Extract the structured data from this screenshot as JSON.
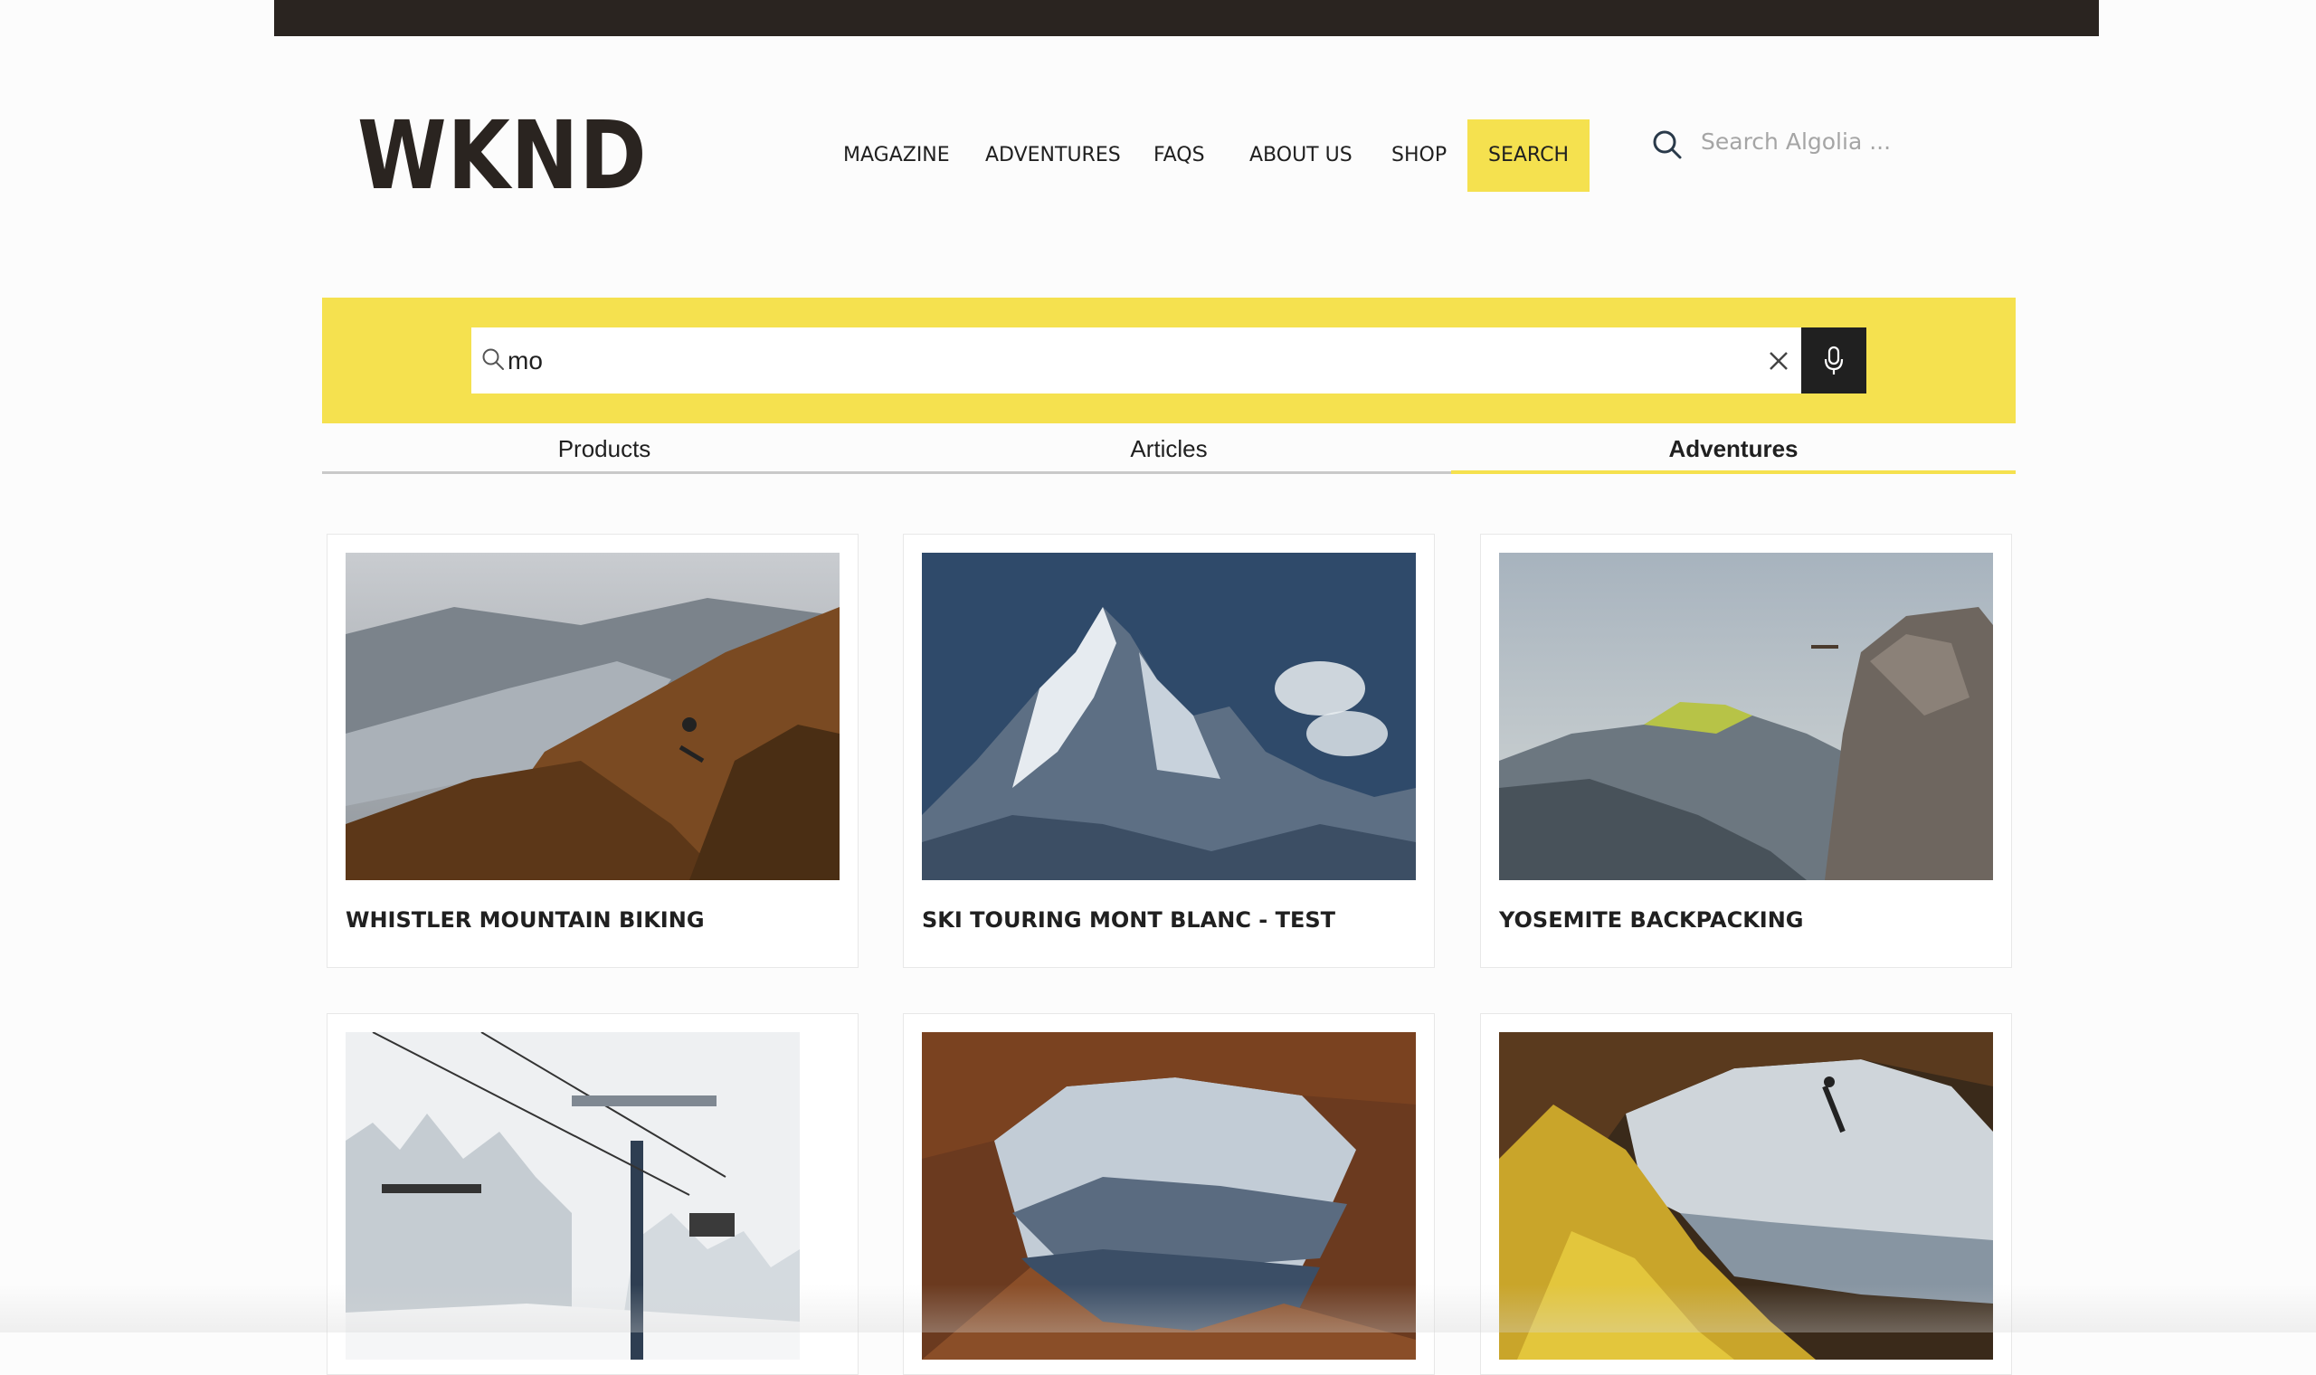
{
  "header": {
    "logo": "WKND",
    "nav": [
      {
        "label": "MAGAZINE"
      },
      {
        "label": "ADVENTURES"
      },
      {
        "label": "FAQS"
      },
      {
        "label": "ABOUT US"
      },
      {
        "label": "SHOP"
      }
    ],
    "search_button": "SEARCH",
    "algolia_placeholder": "Search Algolia ..."
  },
  "search": {
    "query": "mo",
    "accent": "#f5e14f"
  },
  "tabs": [
    {
      "label": "Products"
    },
    {
      "label": "Articles"
    },
    {
      "label": "Adventures",
      "active": true
    }
  ],
  "results": [
    {
      "title": "WHISTLER MOUNTAIN BIKING",
      "image": "mountain-biker-forest-lake"
    },
    {
      "title": "SKI TOURING MONT BLANC - TEST",
      "image": "snowy-mountain-peak"
    },
    {
      "title": "YOSEMITE BACKPACKING",
      "image": "half-dome-cliff-climber"
    },
    {
      "title": "",
      "image": "ski-chairlift-snow-trees"
    },
    {
      "title": "",
      "image": "rock-arch-valley-view"
    },
    {
      "title": "",
      "image": "cave-climber-lake"
    }
  ],
  "icons": {
    "algolia": "search-icon",
    "input": "search-icon",
    "clear": "close-icon",
    "voice": "microphone-icon"
  }
}
